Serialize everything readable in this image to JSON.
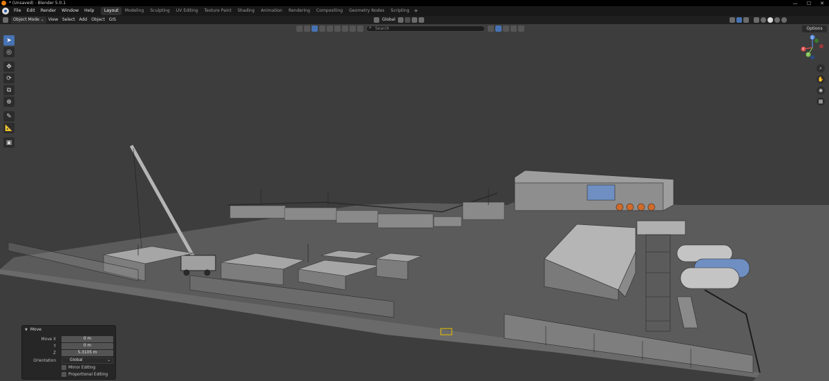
{
  "window": {
    "title": "* (Unsaved) - Blender 5.0.1",
    "controls": {
      "minimize": "—",
      "maximize": "☐",
      "close": "✕"
    }
  },
  "menu": {
    "items": [
      "File",
      "Edit",
      "Render",
      "Window",
      "Help"
    ]
  },
  "workspaces": {
    "active": "Layout",
    "tabs": [
      "Layout",
      "Modeling",
      "Sculpting",
      "UV Editing",
      "Texture Paint",
      "Shading",
      "Animation",
      "Rendering",
      "Compositing",
      "Geometry Nodes",
      "Scripting"
    ],
    "add_label": "+"
  },
  "viewport_header": {
    "mode": "Object Mode",
    "menus": [
      "View",
      "Select",
      "Add",
      "Object",
      "GIS"
    ],
    "transform_orientation": "Global",
    "snap_icon": "magnet-icon",
    "pivot_icon": "pivot-icon"
  },
  "viewport_overlay": {
    "search_placeholder": "Search",
    "options_label": "Options",
    "axis_labels": {
      "x": "X",
      "y": "Y",
      "z": "Z"
    }
  },
  "toolbar": {
    "tools": [
      {
        "name": "select-box",
        "icon": "cursor-icon",
        "glyph": "➤",
        "active": true
      },
      {
        "name": "cursor",
        "icon": "3d-cursor-icon",
        "glyph": "◎",
        "active": false
      },
      {
        "name": "move",
        "icon": "move-icon",
        "glyph": "✥",
        "active": false
      },
      {
        "name": "rotate",
        "icon": "rotate-icon",
        "glyph": "⟳",
        "active": false
      },
      {
        "name": "scale",
        "icon": "scale-icon",
        "glyph": "⧉",
        "active": false
      },
      {
        "name": "transform",
        "icon": "transform-icon",
        "glyph": "⊕",
        "active": false
      },
      {
        "name": "annotate",
        "icon": "annotate-icon",
        "glyph": "✎",
        "active": false
      },
      {
        "name": "measure",
        "icon": "measure-icon",
        "glyph": "📐",
        "active": false
      },
      {
        "name": "add-cube",
        "icon": "add-cube-icon",
        "glyph": "▣",
        "active": false
      }
    ]
  },
  "operator_panel": {
    "title": "Move",
    "fields": [
      {
        "label": "Move X",
        "value": "0 m"
      },
      {
        "label": "Y",
        "value": "0 m"
      },
      {
        "label": "Z",
        "value": "5.3105 m"
      }
    ],
    "orientation_label": "Orientation",
    "orientation_value": "Global",
    "checkboxes": [
      {
        "label": "Mirror Editing",
        "checked": false
      },
      {
        "label": "Proportional Editing",
        "checked": false
      }
    ]
  },
  "colors": {
    "accent": "#4772b3",
    "viewport_bg": "#3d3d3d",
    "ground": "#606060",
    "blender_orange": "#e87d0d",
    "tank_blue": "#6f8fc2"
  }
}
